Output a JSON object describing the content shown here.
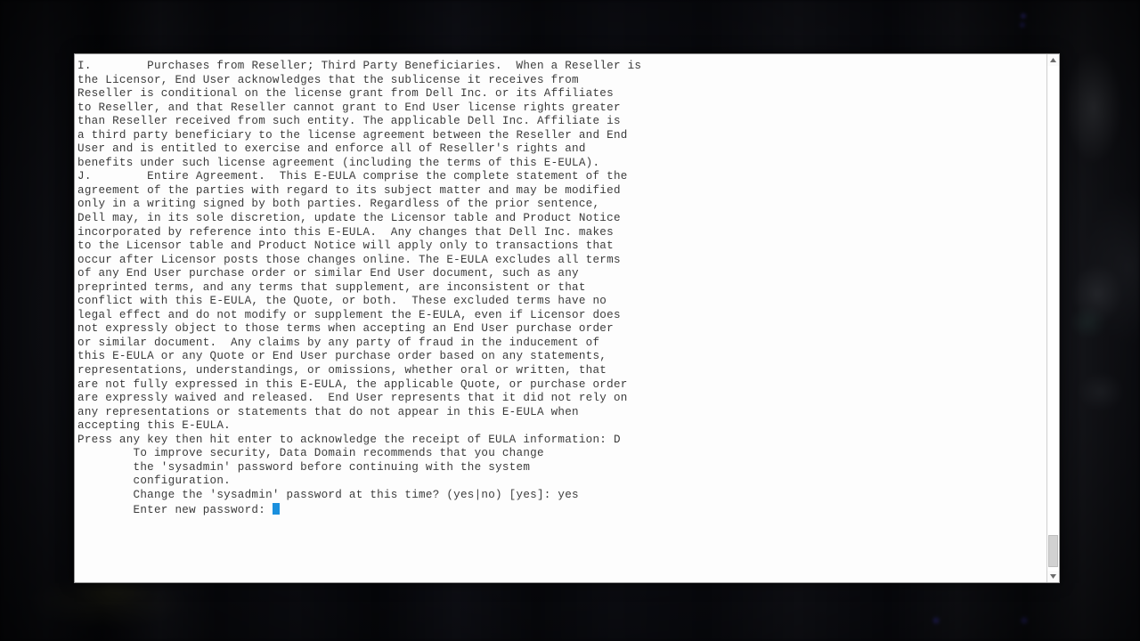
{
  "window": {
    "kind": "terminal-console",
    "background_description": "blurred dark datacenter server racks",
    "text_color": "#3b3b3b",
    "surface_color": "#ffffff",
    "cursor_color": "#1a8fdd"
  },
  "terminal": {
    "eula_text": "I.\t  Purchases from Reseller; Third Party Beneficiaries.  When a Reseller is\nthe Licensor, End User acknowledges that the sublicense it receives from\nReseller is conditional on the license grant from Dell Inc. or its Affiliates\nto Reseller, and that Reseller cannot grant to End User license rights greater\nthan Reseller received from such entity. The applicable Dell Inc. Affiliate is\na third party beneficiary to the license agreement between the Reseller and End\nUser and is entitled to exercise and enforce all of Reseller's rights and\nbenefits under such license agreement (including the terms of this E-EULA).\nJ.\t  Entire Agreement.  This E-EULA comprise the complete statement of the\nagreement of the parties with regard to its subject matter and may be modified\nonly in a writing signed by both parties. Regardless of the prior sentence,\nDell may, in its sole discretion, update the Licensor table and Product Notice\nincorporated by reference into this E-EULA.  Any changes that Dell Inc. makes\nto the Licensor table and Product Notice will apply only to transactions that\noccur after Licensor posts those changes online. The E-EULA excludes all terms\nof any End User purchase order or similar End User document, such as any\npreprinted terms, and any terms that supplement, are inconsistent or that\nconflict with this E-EULA, the Quote, or both.  These excluded terms have no\nlegal effect and do not modify or supplement the E-EULA, even if Licensor does\nnot expressly object to those terms when accepting an End User purchase order\nor similar document.  Any claims by any party of fraud in the inducement of\nthis E-EULA or any Quote or End User purchase order based on any statements,\nrepresentations, understandings, or omissions, whether oral or written, that\nare not fully expressed in this E-EULA, the applicable Quote, or purchase order\nare expressly waived and released.  End User represents that it did not rely on\nany representations or statements that do not appear in this E-EULA when\naccepting this E-EULA.",
    "acknowledge_prompt": "Press any key then hit enter to acknowledge the receipt of EULA information: D",
    "security_notice": "        To improve security, Data Domain recommends that you change\n        the 'sysadmin' password before continuing with the system\n        configuration.",
    "change_password_prompt": "        Change the 'sysadmin' password at this time? (yes|no) [yes]: yes",
    "enter_password_prompt": "        Enter new password: "
  },
  "scrollbar": {
    "up_arrow_icon": "triangle-up-icon",
    "down_arrow_icon": "triangle-down-icon",
    "thumb_position": "near-bottom"
  }
}
